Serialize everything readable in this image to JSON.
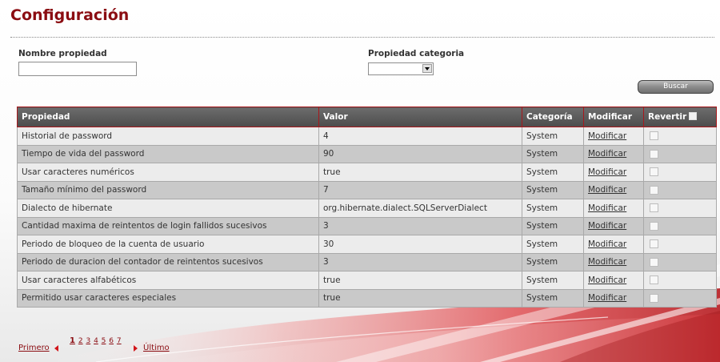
{
  "page": {
    "title": "Configuración"
  },
  "filters": {
    "name_label": "Nombre propiedad",
    "name_value": "",
    "name_placeholder": "",
    "category_label": "Propiedad categoria",
    "category_value": "",
    "search_label": "Buscar"
  },
  "table": {
    "headers": {
      "property": "Propiedad",
      "value": "Valor",
      "category": "Categoría",
      "modify": "Modificar",
      "revert": "Revertir"
    },
    "rows": [
      {
        "property": "Historial de password",
        "value": "4",
        "category": "System",
        "modify": "Modificar"
      },
      {
        "property": "Tiempo de vida del password",
        "value": "90",
        "category": "System",
        "modify": "Modificar"
      },
      {
        "property": "Usar caracteres numéricos",
        "value": "true",
        "category": "System",
        "modify": "Modificar"
      },
      {
        "property": "Tamaño mínimo del password",
        "value": "7",
        "category": "System",
        "modify": "Modificar"
      },
      {
        "property": "Dialecto de hibernate",
        "value": "org.hibernate.dialect.SQLServerDialect",
        "category": "System",
        "modify": "Modificar"
      },
      {
        "property": "Cantidad maxima de reintentos de login fallidos sucesivos",
        "value": "3",
        "category": "System",
        "modify": "Modificar"
      },
      {
        "property": "Periodo de bloqueo de la cuenta de usuario",
        "value": "30",
        "category": "System",
        "modify": "Modificar"
      },
      {
        "property": "Periodo de duracion del contador de reintentos sucesivos",
        "value": "3",
        "category": "System",
        "modify": "Modificar"
      },
      {
        "property": "Usar caracteres alfabéticos",
        "value": "true",
        "category": "System",
        "modify": "Modificar"
      },
      {
        "property": "Permitido usar caracteres especiales",
        "value": "true",
        "category": "System",
        "modify": "Modificar"
      }
    ]
  },
  "pagination": {
    "first": "Primero",
    "last": "Último",
    "pages": [
      "1",
      "2",
      "3",
      "4",
      "5",
      "6",
      "7"
    ],
    "current": "1"
  },
  "colors": {
    "title": "#8b0d12",
    "header_bg": "#5a5a5a",
    "header_border": "#a8181c",
    "row_odd": "#ececec",
    "row_even": "#c9c9c9",
    "accent_red": "#d1141a"
  }
}
